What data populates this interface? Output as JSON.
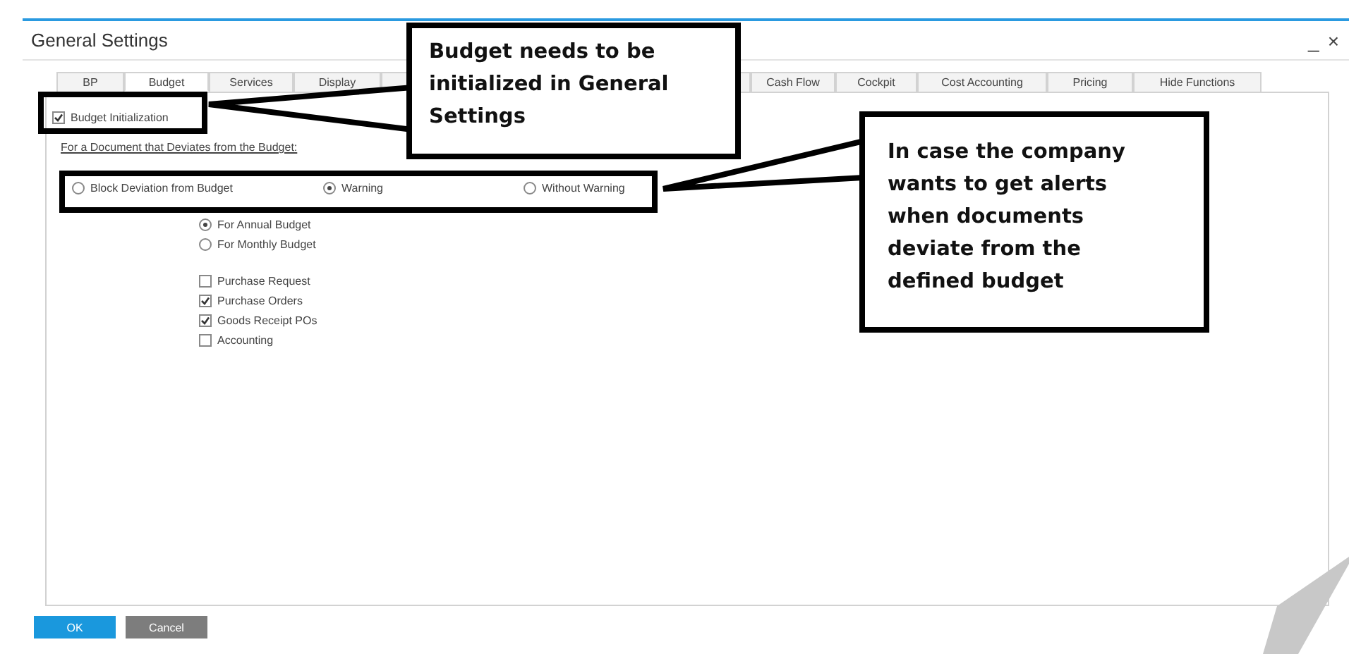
{
  "window": {
    "title": "General Settings",
    "minimize": "_",
    "close": "×"
  },
  "tabs": [
    {
      "label": "BP",
      "selected": false
    },
    {
      "label": "Budget",
      "selected": true
    },
    {
      "label": "Services",
      "selected": false
    },
    {
      "label": "Display",
      "selected": false
    },
    {
      "label": "Cash Flow",
      "selected": false
    },
    {
      "label": "Cockpit",
      "selected": false
    },
    {
      "label": "Cost Accounting",
      "selected": false
    },
    {
      "label": "Pricing",
      "selected": false
    },
    {
      "label": "Hide Functions",
      "selected": false
    }
  ],
  "budget_initialization": {
    "label": "Budget Initialization",
    "checked": true
  },
  "deviation": {
    "heading": "For a Document that Deviates from the Budget:",
    "options": [
      {
        "label": "Block Deviation from Budget",
        "selected": false
      },
      {
        "label": "Warning",
        "selected": true
      },
      {
        "label": "Without Warning",
        "selected": false
      }
    ]
  },
  "period": [
    {
      "label": "For Annual Budget",
      "selected": true
    },
    {
      "label": "For Monthly Budget",
      "selected": false
    }
  ],
  "documents": [
    {
      "label": "Purchase Request",
      "checked": false
    },
    {
      "label": "Purchase Orders",
      "checked": true
    },
    {
      "label": "Goods Receipt POs",
      "checked": true
    },
    {
      "label": "Accounting",
      "checked": false
    }
  ],
  "buttons": [
    {
      "label": "OK",
      "kind": "primary"
    },
    {
      "label": "Cancel",
      "kind": "secondary"
    }
  ],
  "callouts": [
    {
      "text": "Budget needs to be initialized in General Settings"
    },
    {
      "text": "In case the company wants to get alerts when documents deviate from the defined budget"
    }
  ]
}
